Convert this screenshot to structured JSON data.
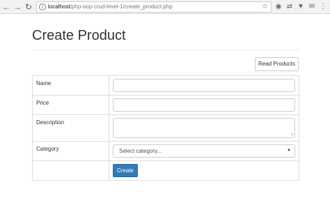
{
  "browser": {
    "url_host": "localhost",
    "url_path": "/php-oop-crud-level-1/create_product.php"
  },
  "page": {
    "title": "Create Product",
    "read_button": "Read Products"
  },
  "form": {
    "name_label": "Name",
    "price_label": "Price",
    "description_label": "Description",
    "category_label": "Category",
    "category_selected": "Select category...",
    "submit_label": "Create"
  }
}
